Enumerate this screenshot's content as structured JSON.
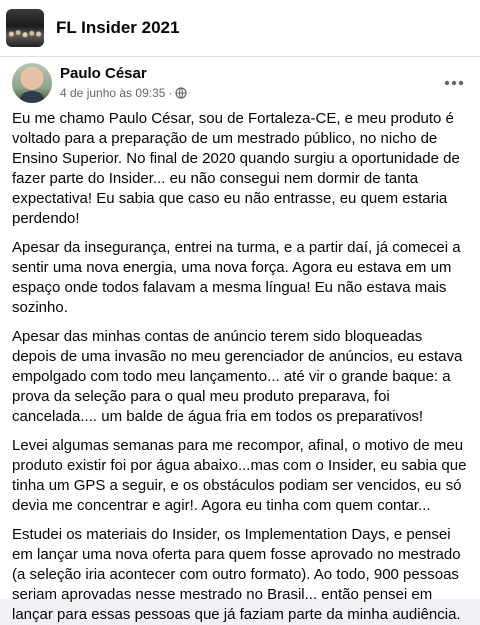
{
  "group": {
    "title": "FL Insider 2021"
  },
  "post": {
    "author": "Paulo César",
    "timestamp": "4 de junho às 09:35",
    "separator": "·",
    "paragraphs": [
      "Eu me chamo Paulo César, sou de Fortaleza-CE, e meu produto é voltado para a preparação de um mestrado público, no nicho de Ensino Superior. No final de 2020 quando surgiu a oportunidade de fazer parte do Insider... eu não consegui nem dormir de tanta expectativa! Eu sabia que caso eu não entrasse, eu quem estaria perdendo!",
      "Apesar da insegurança, entrei na turma, e a partir daí, já comecei a sentir uma nova energia, uma nova força. Agora eu estava em um espaço onde todos falavam a mesma língua! Eu não estava mais sozinho.",
      "Apesar das minhas contas de anúncio terem sido bloqueadas depois de uma invasão no meu gerenciador de anúncios, eu estava empolgado com todo meu lançamento... até vir o grande baque: a prova da seleção para o qual meu produto preparava, foi cancelada.... um balde de água fria em todos os preparativos!",
      "Levei algumas semanas para me recompor, afinal, o motivo de meu produto existir foi por água abaixo...mas com o Insider, eu sabia que tinha um GPS a seguir, e os obstáculos podiam ser vencidos, eu só devia me concentrar e agir!. Agora eu tinha com quem contar...",
      "Estudei os materiais do Insider, os Implementation Days, e pensei em lançar uma nova oferta para quem fosse aprovado no mestrado (a seleção iria acontecer com outro formato). Ao todo, 900 pessoas seriam aprovadas nesse mestrado no Brasil... então pensei em lançar para essas pessoas que já faziam parte da minha audiência."
    ]
  },
  "icons": {
    "group_thumb": "group-cover-image",
    "avatar": "profile-photo",
    "privacy": "globe-icon",
    "more": "more-options-icon"
  }
}
